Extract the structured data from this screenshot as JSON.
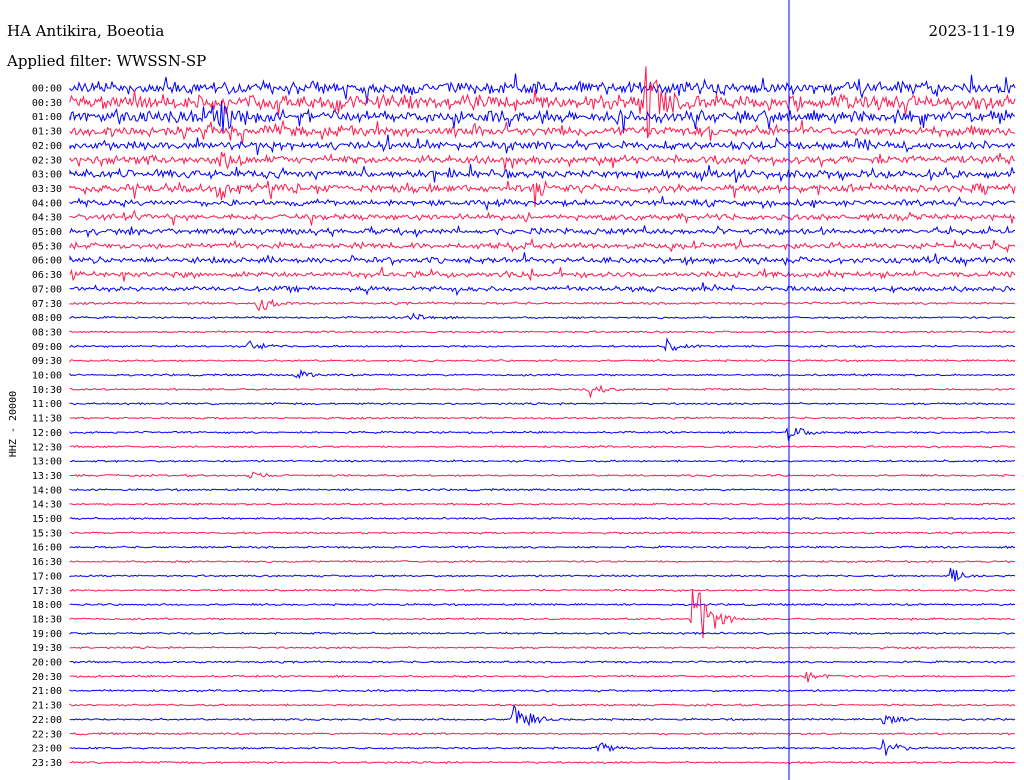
{
  "header": {
    "station": "HA Antikira, Boeotia",
    "date": "2023-11-19",
    "filter": "Applied filter: WWSSN-SP"
  },
  "chart_data": {
    "type": "line",
    "title": "HA Antikira, Boeotia",
    "subtitle": "Applied filter: WWSSN-SP",
    "date": "2023-11-19",
    "ylabel": "HHZ - 20000",
    "row_labels": [
      "00:00",
      "00:30",
      "01:00",
      "01:30",
      "02:00",
      "02:30",
      "03:00",
      "03:30",
      "04:00",
      "04:30",
      "05:00",
      "05:30",
      "06:00",
      "06:30",
      "07:00",
      "07:30",
      "08:00",
      "08:30",
      "09:00",
      "09:30",
      "10:00",
      "10:30",
      "11:00",
      "11:30",
      "12:00",
      "12:30",
      "13:00",
      "13:30",
      "14:00",
      "14:30",
      "15:00",
      "15:30",
      "16:00",
      "16:30",
      "17:00",
      "17:30",
      "18:00",
      "18:30",
      "19:00",
      "19:30",
      "20:00",
      "20:30",
      "21:00",
      "21:30",
      "22:00",
      "22:30",
      "23:00",
      "23:30"
    ],
    "trace_colors": [
      "#0000ff",
      "#ff1a4d"
    ],
    "row_noise_level": [
      6,
      7,
      6,
      5,
      4,
      4,
      4,
      4,
      3,
      3,
      3,
      3,
      3,
      3,
      2.5,
      1.2,
      1,
      1,
      1,
      1,
      1,
      1,
      1,
      1,
      1,
      1,
      1,
      1,
      1,
      1,
      1,
      1,
      1,
      1,
      1,
      1,
      1,
      1,
      1,
      1,
      1,
      1,
      1,
      1,
      1,
      1,
      1,
      1
    ],
    "events": [
      {
        "row": 2,
        "x_frac": 0.16,
        "amplitude": 14
      },
      {
        "row": 5,
        "x_frac": 0.16,
        "amplitude": 12
      },
      {
        "row": 7,
        "x_frac": 0.16,
        "amplitude": 10
      },
      {
        "row": 7,
        "x_frac": 0.49,
        "amplitude": 12
      },
      {
        "row": 1,
        "x_frac": 0.61,
        "amplitude": 40
      },
      {
        "row": 15,
        "x_frac": 0.2,
        "amplitude": 9
      },
      {
        "row": 16,
        "x_frac": 0.36,
        "amplitude": 7
      },
      {
        "row": 18,
        "x_frac": 0.19,
        "amplitude": 6
      },
      {
        "row": 18,
        "x_frac": 0.63,
        "amplitude": 7
      },
      {
        "row": 20,
        "x_frac": 0.24,
        "amplitude": 5
      },
      {
        "row": 21,
        "x_frac": 0.55,
        "amplitude": 7
      },
      {
        "row": 24,
        "x_frac": 0.76,
        "amplitude": 10
      },
      {
        "row": 27,
        "x_frac": 0.19,
        "amplitude": 4
      },
      {
        "row": 34,
        "x_frac": 0.93,
        "amplitude": 9
      },
      {
        "row": 37,
        "x_frac": 0.66,
        "amplitude": 60
      },
      {
        "row": 41,
        "x_frac": 0.78,
        "amplitude": 6
      },
      {
        "row": 44,
        "x_frac": 0.47,
        "amplitude": 22
      },
      {
        "row": 44,
        "x_frac": 0.86,
        "amplitude": 7
      },
      {
        "row": 46,
        "x_frac": 0.56,
        "amplitude": 6
      },
      {
        "row": 46,
        "x_frac": 0.86,
        "amplitude": 9
      }
    ]
  }
}
